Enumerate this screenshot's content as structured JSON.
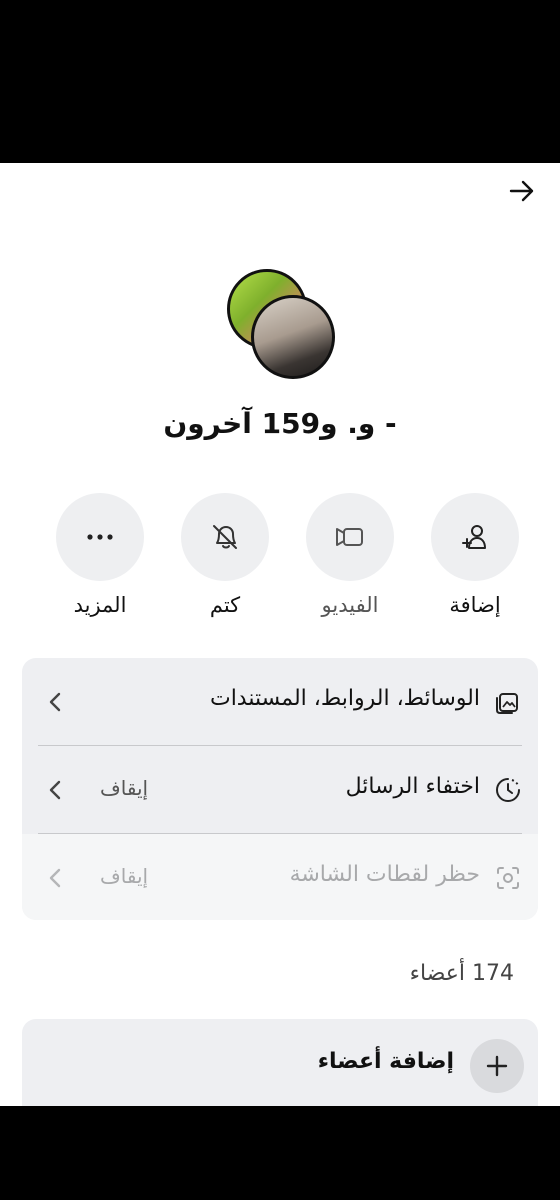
{
  "header": {
    "back_icon": "arrow-right-icon"
  },
  "group": {
    "title": "- و. و159 آخرون",
    "avatars": [
      "avatar-photo-1",
      "avatar-photo-2"
    ]
  },
  "actions": [
    {
      "label": "إضافة",
      "icon": "add-person-icon"
    },
    {
      "label": "الفيديو",
      "icon": "video-icon"
    },
    {
      "label": "كتم",
      "icon": "bell-slash-icon"
    },
    {
      "label": "المزيد",
      "icon": "more-dots-icon"
    }
  ],
  "settings": [
    {
      "label": "الوسائط، الروابط، المستندات",
      "value": "",
      "icon": "media-icon"
    },
    {
      "label": "اختفاء الرسائل",
      "value": "إيقاف",
      "icon": "timer-icon"
    },
    {
      "label": "حظر لقطات الشاشة",
      "value": "إيقاف",
      "icon": "screenshot-icon",
      "disabled": true
    }
  ],
  "members": {
    "count_label": "174 أعضاء",
    "add_label": "إضافة أعضاء"
  },
  "colors": {
    "card_bg": "#eeeff2",
    "accent": "#111111"
  }
}
